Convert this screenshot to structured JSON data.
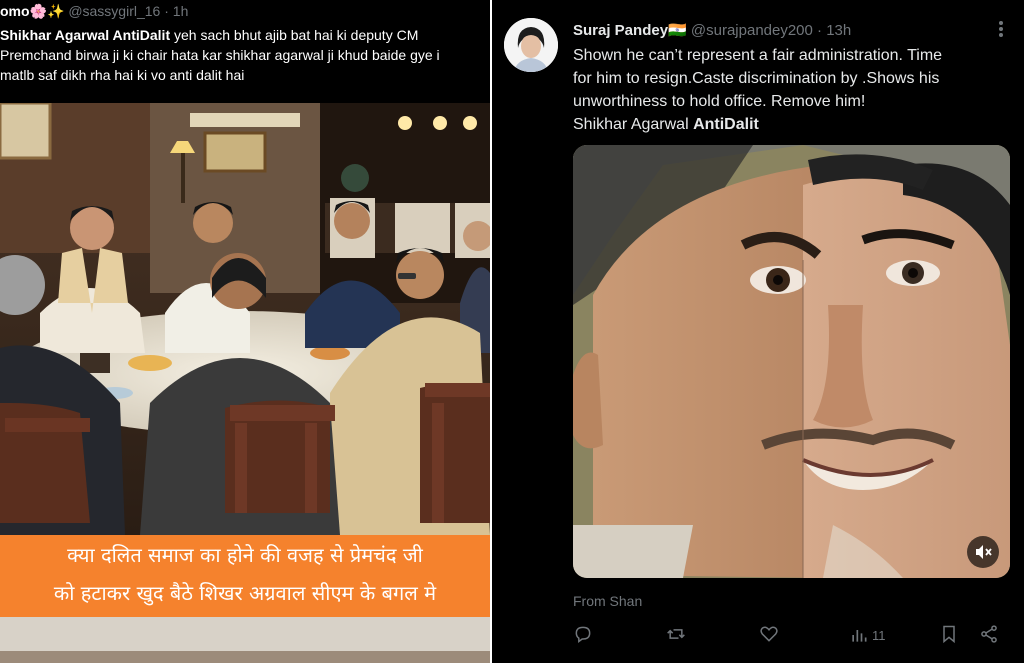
{
  "left_tweet": {
    "author": "omo🌸✨",
    "handle": "@sassygirl_16",
    "time": "· 1h",
    "lines": [
      {
        "bold": "Shikhar Agarwal AntiDalit",
        "text": " yeh sach bhut ajib bat hai ki deputy CM"
      },
      {
        "bold": "",
        "text": "Premchand birwa ji ki chair hata kar shikhar agarwal ji khud baide gye i"
      },
      {
        "bold": "",
        "text": "matlb saf dikh rha hai ki vo anti dalit hai"
      }
    ],
    "banner_lines": [
      "क्या दलित समाज का होने की वजह से प्रेमचंद जी",
      "को हटाकर खुद बैठे शिखर अग्रवाल सीएम  के बगल मे"
    ]
  },
  "right_tweet": {
    "author": "Suraj Pandey🇮🇳",
    "handle": "@surajpandey200",
    "time": "· 13h",
    "text_lines": [
      "Shown he can’t represent a fair administration. Time",
      "for him to resign.Caste discrimination by .Shows his",
      "unworthiness to hold office. Remove him!"
    ],
    "last_line_plain": "Shikhar Agarwal ",
    "last_line_bold": "AntiDalit",
    "from": "From Shan",
    "views_count": "11",
    "icons": {
      "reply": "reply-icon",
      "retweet": "retweet-icon",
      "like": "heart-icon",
      "views": "views-icon",
      "bookmark": "bookmark-icon",
      "share": "share-icon",
      "mute": "mute-icon",
      "more": "more-icon"
    }
  }
}
